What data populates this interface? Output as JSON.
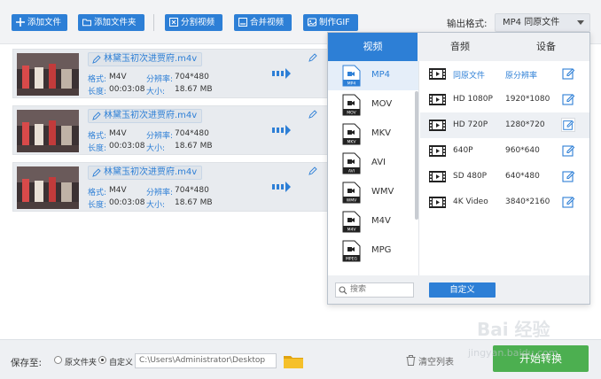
{
  "toolbar": {
    "add_file": "添加文件",
    "add_folder": "添加文件夹",
    "split_video": "分割视频",
    "merge_video": "合并视频",
    "make_gif": "制作GIF",
    "output_format_label": "输出格式:",
    "output_format_value": "MP4  同原文件"
  },
  "files": [
    {
      "name": "林黛玉初次进贾府.m4v",
      "format_label": "格式:",
      "format": "M4V",
      "res_label": "分辨率:",
      "resolution": "704*480",
      "dur_label": "长度:",
      "duration": "00:03:08",
      "size_label": "大小:",
      "size": "18.67 MB"
    },
    {
      "name": "林黛玉初次进贾府.m4v",
      "format_label": "格式:",
      "format": "M4V",
      "res_label": "分辨率:",
      "resolution": "704*480",
      "dur_label": "长度:",
      "duration": "00:03:08",
      "size_label": "大小:",
      "size": "18.67 MB"
    },
    {
      "name": "林黛玉初次进贾府.m4v",
      "format_label": "格式:",
      "format": "M4V",
      "res_label": "分辨率:",
      "resolution": "704*480",
      "dur_label": "长度:",
      "duration": "00:03:08",
      "size_label": "大小:",
      "size": "18.67 MB"
    }
  ],
  "format_popup": {
    "tabs": [
      "视频",
      "音频",
      "设备"
    ],
    "formats": [
      "MP4",
      "MOV",
      "MKV",
      "AVI",
      "WMV",
      "M4V",
      "MPG"
    ],
    "format_icon_tags": [
      "MP4",
      "MOV",
      "MKV",
      "AVI",
      "WMV",
      "M4V",
      "MPEG"
    ],
    "resolutions": [
      {
        "name": "同原文件",
        "value": "原分辨率"
      },
      {
        "name": "HD 1080P",
        "value": "1920*1080"
      },
      {
        "name": "HD 720P",
        "value": "1280*720"
      },
      {
        "name": "640P",
        "value": "960*640"
      },
      {
        "name": "SD 480P",
        "value": "640*480"
      },
      {
        "name": "4K Video",
        "value": "3840*2160"
      }
    ],
    "search_placeholder": "搜索",
    "custom_button": "自定义"
  },
  "bottom": {
    "save_to": "保存至:",
    "option_source": "原文件夹",
    "option_custom": "自定义",
    "path": "C:\\Users\\Administrator\\Desktop",
    "clear_list": "清空列表",
    "start": "开始转换"
  },
  "watermark": {
    "line1": "Bai 经验",
    "line2": "jingyan.baidu.com"
  },
  "colors": {
    "accent": "#2d7fd6",
    "start": "#4caf50"
  }
}
